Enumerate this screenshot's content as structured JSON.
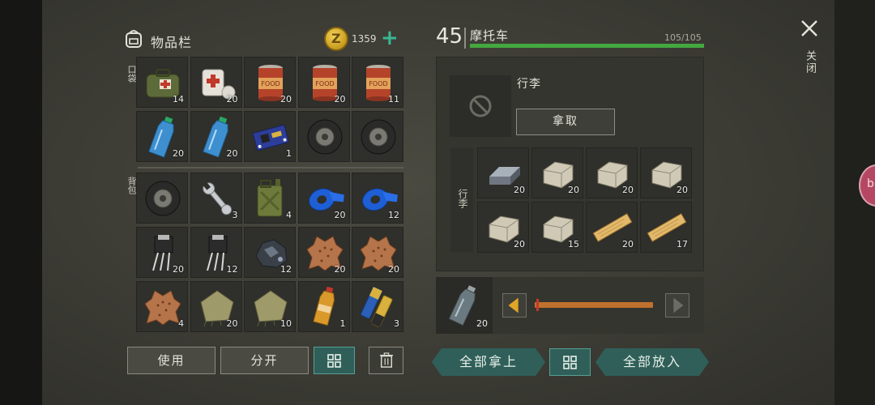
{
  "inventory": {
    "title": "物品栏",
    "coins": "1359",
    "coin_symbol": "Z",
    "pocket_label": "口袋",
    "backpack_label": "背包",
    "pocket_items": [
      {
        "icon": "medkit-bag-icon",
        "count": "14"
      },
      {
        "icon": "bandage-icon",
        "count": "20"
      },
      {
        "icon": "food-can-icon",
        "count": "20"
      },
      {
        "icon": "food-can-icon",
        "count": "20"
      },
      {
        "icon": "food-can-icon",
        "count": "11"
      },
      {
        "icon": "water-bottle-icon",
        "count": "20"
      },
      {
        "icon": "water-bottle-icon",
        "count": "20"
      },
      {
        "icon": "circuit-board-icon",
        "count": "1"
      },
      {
        "icon": "tire-icon",
        "count": ""
      },
      {
        "icon": "tire-icon",
        "count": ""
      }
    ],
    "backpack_items": [
      {
        "icon": "tire-icon",
        "count": ""
      },
      {
        "icon": "wrench-icon",
        "count": "3"
      },
      {
        "icon": "jerrycan-icon",
        "count": "4"
      },
      {
        "icon": "blue-tape-icon",
        "count": "20"
      },
      {
        "icon": "blue-tape-icon",
        "count": "12"
      },
      {
        "icon": "transistor-icon",
        "count": "20"
      },
      {
        "icon": "transistor-icon",
        "count": "12"
      },
      {
        "icon": "coal-ore-icon",
        "count": "12"
      },
      {
        "icon": "animal-hide-icon",
        "count": "20"
      },
      {
        "icon": "animal-hide-icon",
        "count": "20"
      },
      {
        "icon": "animal-hide-icon",
        "count": "4"
      },
      {
        "icon": "cloth-icon",
        "count": "20"
      },
      {
        "icon": "cloth-icon",
        "count": "10"
      },
      {
        "icon": "soda-bottle-icon",
        "count": "1"
      },
      {
        "icon": "batteries-icon",
        "count": "3"
      }
    ],
    "use_label": "使用",
    "split_label": "分开"
  },
  "vehicle": {
    "level": "45",
    "name": "摩托车",
    "hp_text": "105/105",
    "hp_fraction": 1.0,
    "hp_color": "#43a83f",
    "luggage_title": "行李",
    "luggage_side": "行李",
    "take_label": "拿取",
    "storage_items": [
      {
        "icon": "steel-ingot-icon",
        "count": "20"
      },
      {
        "icon": "stone-block-icon",
        "count": "20"
      },
      {
        "icon": "stone-block-icon",
        "count": "20"
      },
      {
        "icon": "stone-block-icon",
        "count": "20"
      },
      {
        "icon": "stone-block-icon",
        "count": "20"
      },
      {
        "icon": "stone-block-icon",
        "count": "15"
      },
      {
        "icon": "wood-plank-icon",
        "count": "20"
      },
      {
        "icon": "wood-plank-icon",
        "count": "17"
      }
    ],
    "transfer_count": "20",
    "take_all_label": "全部拿上",
    "put_all_label": "全部放入"
  },
  "close_label": "关闭",
  "colors": {
    "accent_teal": "#2f5f58",
    "coin_gold": "#e0b530",
    "plus_green": "#3ab794"
  }
}
